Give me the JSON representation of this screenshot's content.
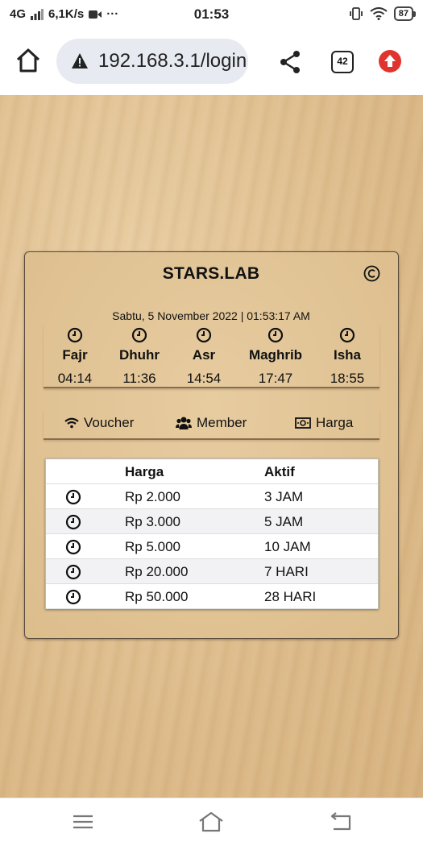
{
  "status_bar": {
    "network": "4G",
    "speed": "6,1K/s",
    "more": "···",
    "time": "01:53",
    "battery": "87"
  },
  "browser": {
    "url": "192.168.3.1/login",
    "tab_count": "42",
    "icons": [
      "home-icon",
      "warning-icon",
      "share-icon",
      "tabs-icon",
      "update-icon"
    ]
  },
  "card": {
    "brand": "STARS.LAB",
    "datetime": "Sabtu, 5 November 2022 | 01:53:17 AM",
    "prayers": [
      {
        "name": "Fajr",
        "time": "04:14"
      },
      {
        "name": "Dhuhr",
        "time": "11:36"
      },
      {
        "name": "Asr",
        "time": "14:54"
      },
      {
        "name": "Maghrib",
        "time": "17:47"
      },
      {
        "name": "Isha",
        "time": "18:55"
      }
    ],
    "menu": {
      "voucher": "Voucher",
      "member": "Member",
      "harga": "Harga"
    },
    "table": {
      "headers": {
        "harga": "Harga",
        "aktif": "Aktif"
      },
      "rows": [
        {
          "harga": "Rp 2.000",
          "aktif": "3 JAM"
        },
        {
          "harga": "Rp 3.000",
          "aktif": "5 JAM"
        },
        {
          "harga": "Rp 5.000",
          "aktif": "10 JAM"
        },
        {
          "harga": "Rp 20.000",
          "aktif": "7 HARI"
        },
        {
          "harga": "Rp 50.000",
          "aktif": "28 HARI"
        }
      ]
    }
  },
  "colors": {
    "wood": "#dcbd8c",
    "card_border": "#5b4b3c",
    "update_red": "#e0352f"
  }
}
